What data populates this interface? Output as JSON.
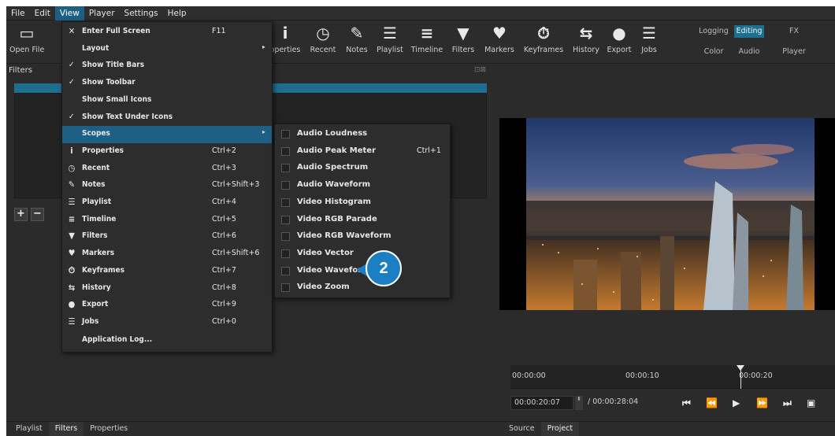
{
  "menubar": {
    "items": [
      {
        "label": "File"
      },
      {
        "label": "Edit"
      },
      {
        "label": "View"
      },
      {
        "label": "Player"
      },
      {
        "label": "Settings"
      },
      {
        "label": "Help"
      }
    ]
  },
  "toolbar": {
    "open_file": "Open File",
    "properties": "operties",
    "recent": "Recent",
    "notes": "Notes",
    "playlist": "Playlist",
    "timeline": "Timeline",
    "filters": "Filters",
    "markers": "Markers",
    "keyframes": "Keyframes",
    "history": "History",
    "export": "Export",
    "jobs": "Jobs",
    "workspaces": {
      "logging": "Logging",
      "editing": "Editing",
      "fx": "FX",
      "color": "Color",
      "audio": "Audio",
      "player": "Player"
    }
  },
  "filters_panel": {
    "title": "Filters",
    "add": "+",
    "remove": "−",
    "controls": "⊡⊠"
  },
  "view_menu": {
    "items": [
      {
        "label": "Enter Full Screen",
        "shortcut": "F11",
        "icon": "fullscreen-icon",
        "glyph": "✕"
      },
      {
        "label": "Layout",
        "arrow": "▸"
      },
      {
        "label": "Show Title Bars",
        "check": "✓"
      },
      {
        "label": "Show Toolbar",
        "check": "✓"
      },
      {
        "label": "Show Small Icons"
      },
      {
        "label": "Show Text Under Icons",
        "check": "✓"
      },
      {
        "label": "Scopes",
        "arrow": "▸"
      },
      {
        "label": "Properties",
        "shortcut": "Ctrl+2",
        "icon": "properties-icon",
        "glyph": "i"
      },
      {
        "label": "Recent",
        "shortcut": "Ctrl+3",
        "icon": "clock-icon",
        "glyph": "◷"
      },
      {
        "label": "Notes",
        "shortcut": "Ctrl+Shift+3",
        "icon": "notes-icon",
        "glyph": "✎"
      },
      {
        "label": "Playlist",
        "shortcut": "Ctrl+4",
        "icon": "playlist-icon",
        "glyph": "☰"
      },
      {
        "label": "Timeline",
        "shortcut": "Ctrl+5",
        "icon": "timeline-icon",
        "glyph": "≡"
      },
      {
        "label": "Filters",
        "shortcut": "Ctrl+6",
        "icon": "funnel-icon",
        "glyph": "▼"
      },
      {
        "label": "Markers",
        "shortcut": "Ctrl+Shift+6",
        "icon": "marker-icon",
        "glyph": "♥"
      },
      {
        "label": "Keyframes",
        "shortcut": "Ctrl+7",
        "icon": "stopwatch-icon",
        "glyph": "⏱"
      },
      {
        "label": "History",
        "shortcut": "Ctrl+8",
        "icon": "history-icon",
        "glyph": "⇆"
      },
      {
        "label": "Export",
        "shortcut": "Ctrl+9",
        "icon": "export-icon",
        "glyph": "●"
      },
      {
        "label": "Jobs",
        "shortcut": "Ctrl+0",
        "icon": "jobs-icon",
        "glyph": "☰"
      },
      {
        "label": "Application Log..."
      }
    ]
  },
  "scopes_menu": {
    "items": [
      {
        "label": "Audio Loudness"
      },
      {
        "label": "Audio Peak Meter",
        "shortcut": "Ctrl+1"
      },
      {
        "label": "Audio Spectrum"
      },
      {
        "label": "Audio Waveform"
      },
      {
        "label": "Video Histogram"
      },
      {
        "label": "Video RGB Parade"
      },
      {
        "label": "Video RGB Waveform"
      },
      {
        "label": "Video Vector"
      },
      {
        "label": "Video Waveform"
      },
      {
        "label": "Video Zoom"
      }
    ]
  },
  "callout": {
    "label": "2"
  },
  "player": {
    "ruler": {
      "ticks": [
        {
          "label": "00:00:00"
        },
        {
          "label": "00:00:10"
        },
        {
          "label": "00:00:20"
        }
      ]
    },
    "current_time": "00:00:20:07",
    "spin_glyph": "⬍",
    "duration": "/ 00:00:28:04",
    "transport": {
      "skip_start": "⏮",
      "rewind": "⏪",
      "play": "▶",
      "fast_forward": "⏩",
      "skip_end": "⏭",
      "fullscreen": "▣"
    }
  },
  "tabs_left": [
    {
      "label": "Playlist"
    },
    {
      "label": "Filters"
    },
    {
      "label": "Properties"
    }
  ],
  "tabs_right": [
    {
      "label": "Source"
    },
    {
      "label": "Project"
    }
  ],
  "colors": {
    "accent": "#1e6f8f",
    "menu_highlight": "#1e5f86",
    "callout": "#1d7fc3"
  }
}
